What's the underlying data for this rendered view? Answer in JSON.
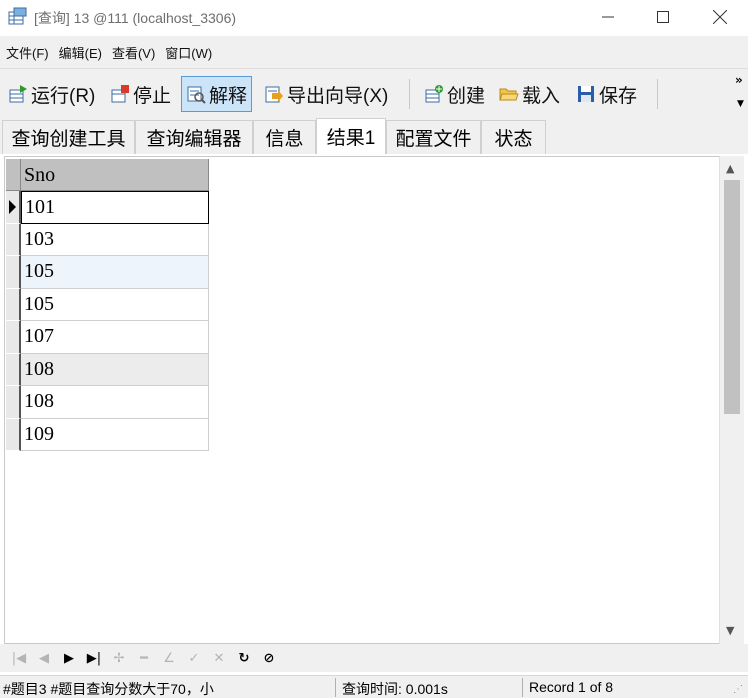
{
  "window": {
    "title": "[查询] 13 @111 (localhost_3306)"
  },
  "menu": {
    "items": [
      "文件(F)",
      "编辑(E)",
      "查看(V)",
      "窗口(W)"
    ]
  },
  "toolbar": {
    "run": "运行(R)",
    "stop": "停止",
    "explain": "解释",
    "export_wizard": "导出向导(X)",
    "create": "创建",
    "load": "载入",
    "save": "保存"
  },
  "tabs": [
    "查询创建工具",
    "查询编辑器",
    "信息",
    "结果1",
    "配置文件",
    "状态"
  ],
  "active_tab": "结果1",
  "grid": {
    "columns": [
      "Sno"
    ],
    "rows": [
      "101",
      "103",
      "105",
      "105",
      "107",
      "108",
      "108",
      "109"
    ]
  },
  "status": {
    "query": "#题目3 #题目查询分数大于70，小",
    "query_time": "查询时间: 0.001s",
    "record": "Record 1 of 8"
  },
  "colors": {
    "accent": "#5b9bd5",
    "active_button_bg": "#cce4f7",
    "header_bg": "#c0c0c0"
  }
}
